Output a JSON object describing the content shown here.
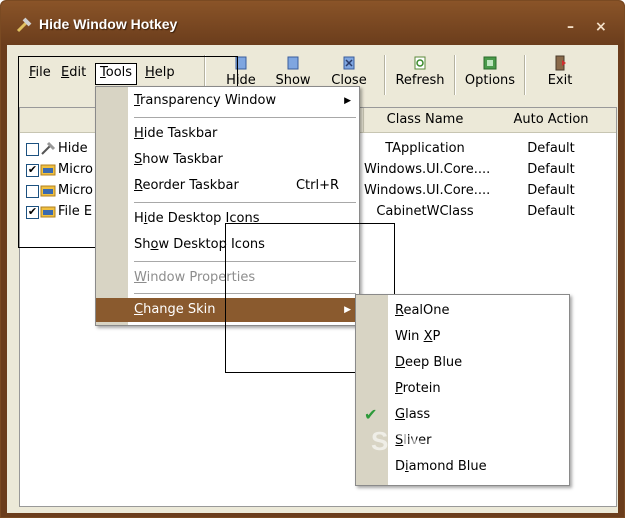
{
  "window": {
    "title": "Hide Window Hotkey",
    "minimize_label": "–",
    "close_label": "×"
  },
  "menubar": [
    {
      "label": "File",
      "ul": "F",
      "rest": "ile"
    },
    {
      "label": "Edit",
      "ul": "E",
      "rest": "dit"
    },
    {
      "label": "Tools",
      "ul": "T",
      "rest": "ools"
    },
    {
      "label": "Help",
      "ul": "H",
      "rest": "elp"
    }
  ],
  "toolbar": {
    "items": [
      {
        "label": "Hide",
        "icon": "hide-icon"
      },
      {
        "label": "Show",
        "icon": "show-icon"
      },
      {
        "label": "Close",
        "icon": "close-window-icon"
      },
      {
        "label": "Refresh",
        "icon": "refresh-icon"
      },
      {
        "label": "Options",
        "icon": "options-icon"
      },
      {
        "label": "Exit",
        "icon": "exit-icon"
      }
    ]
  },
  "table": {
    "columns": [
      "Class Name",
      "Auto Action"
    ],
    "rows": [
      {
        "title": "Hide",
        "checked": false,
        "class_name": "TApplication",
        "auto_action": "Default"
      },
      {
        "title": "Micro",
        "checked": true,
        "class_name": "Windows.UI.Core....",
        "auto_action": "Default"
      },
      {
        "title": "Micro",
        "checked": false,
        "class_name": "Windows.UI.Core....",
        "auto_action": "Default"
      },
      {
        "title": "File E",
        "checked": true,
        "class_name": "CabinetWClass",
        "auto_action": "Default"
      }
    ]
  },
  "tools_menu": {
    "items": [
      {
        "pre": "",
        "ul": "T",
        "post": "ransparency Window",
        "shortcut": "",
        "submenu": true
      },
      {
        "pre": "",
        "ul": "H",
        "post": "ide Taskbar",
        "shortcut": ""
      },
      {
        "pre": "",
        "ul": "S",
        "post": "how Taskbar",
        "shortcut": ""
      },
      {
        "pre": "",
        "ul": "R",
        "post": "eorder Taskbar",
        "shortcut": "Ctrl+R"
      },
      {
        "pre": "H",
        "ul": "i",
        "post": "de Desktop Icons",
        "shortcut": ""
      },
      {
        "pre": "Sh",
        "ul": "o",
        "post": "w Desktop Icons",
        "shortcut": ""
      },
      {
        "pre": "",
        "ul": "W",
        "post": "indow Properties",
        "shortcut": "",
        "disabled": true
      },
      {
        "pre": "",
        "ul": "C",
        "post": "hange Skin",
        "shortcut": "",
        "submenu": true
      }
    ]
  },
  "skin_submenu": {
    "items": [
      {
        "pre": "",
        "ul": "R",
        "post": "ealOne",
        "checked": false
      },
      {
        "pre": "Win ",
        "ul": "X",
        "post": "P",
        "checked": false
      },
      {
        "pre": "",
        "ul": "D",
        "post": "eep Blue",
        "checked": false
      },
      {
        "pre": "",
        "ul": "P",
        "post": "rotein",
        "checked": false
      },
      {
        "pre": "",
        "ul": "G",
        "post": "lass",
        "checked": true
      },
      {
        "pre": "",
        "ul": "S",
        "post": "liver",
        "checked": false
      },
      {
        "pre": "D",
        "ul": "i",
        "post": "amond Blue",
        "checked": false
      }
    ]
  },
  "watermark": "SOFTPEDIA",
  "colors": {
    "title_bar": "#6b3d1c",
    "menu_highlight": "#8a5a2e",
    "check": "#2d9a3a"
  }
}
